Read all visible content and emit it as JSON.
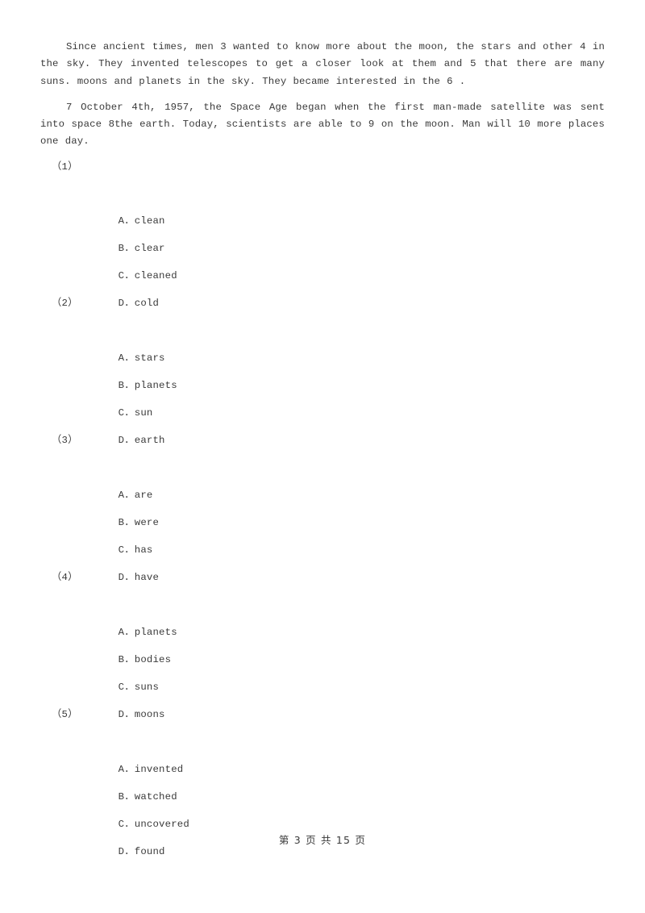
{
  "document": {
    "passages": [
      "Since ancient times, men 3  wanted to know more about the moon, the stars and other  4 in the sky. They invented telescopes to get a closer look at them and 5 that there are many suns. moons and planets in the sky. They became interested in the    6 .",
      "7  October 4th, 1957, the Space Age began when the first man-made satellite was sent into space  8the earth. Today, scientists are able to 9 on the moon. Man will  10  more places one day."
    ],
    "questions": [
      {
        "number": "（1）",
        "options": [
          {
            "letter": "A",
            "sep": "．",
            "text": "clean"
          },
          {
            "letter": "B",
            "sep": "．",
            "text": "clear"
          },
          {
            "letter": "C",
            "sep": "．",
            "text": "cleaned"
          },
          {
            "letter": "D",
            "sep": "．",
            "text": "cold"
          }
        ]
      },
      {
        "number": "（2）",
        "options": [
          {
            "letter": "A",
            "sep": "．",
            "text": "stars"
          },
          {
            "letter": "B",
            "sep": "．",
            "text": "planets"
          },
          {
            "letter": "C",
            "sep": "．",
            "text": "sun"
          },
          {
            "letter": "D",
            "sep": "．",
            "text": "earth"
          }
        ]
      },
      {
        "number": "（3）",
        "options": [
          {
            "letter": "A",
            "sep": "．",
            "text": "are"
          },
          {
            "letter": "B",
            "sep": "．",
            "text": "were"
          },
          {
            "letter": "C",
            "sep": "．",
            "text": "has"
          },
          {
            "letter": "D",
            "sep": "．",
            "text": "have"
          }
        ]
      },
      {
        "number": "（4）",
        "options": [
          {
            "letter": "A",
            "sep": "．",
            "text": "planets"
          },
          {
            "letter": "B",
            "sep": "．",
            "text": "bodies"
          },
          {
            "letter": "C",
            "sep": "．",
            "text": "suns"
          },
          {
            "letter": "D",
            "sep": "．",
            "text": "moons"
          }
        ]
      },
      {
        "number": "（5）",
        "options": [
          {
            "letter": "A",
            "sep": "．",
            "text": "invented"
          },
          {
            "letter": "B",
            "sep": "．",
            "text": "watched"
          },
          {
            "letter": "C",
            "sep": "．",
            "text": "uncovered"
          },
          {
            "letter": "D",
            "sep": "．",
            "text": "found"
          }
        ]
      }
    ],
    "footer": "第 3 页 共 15 页"
  }
}
